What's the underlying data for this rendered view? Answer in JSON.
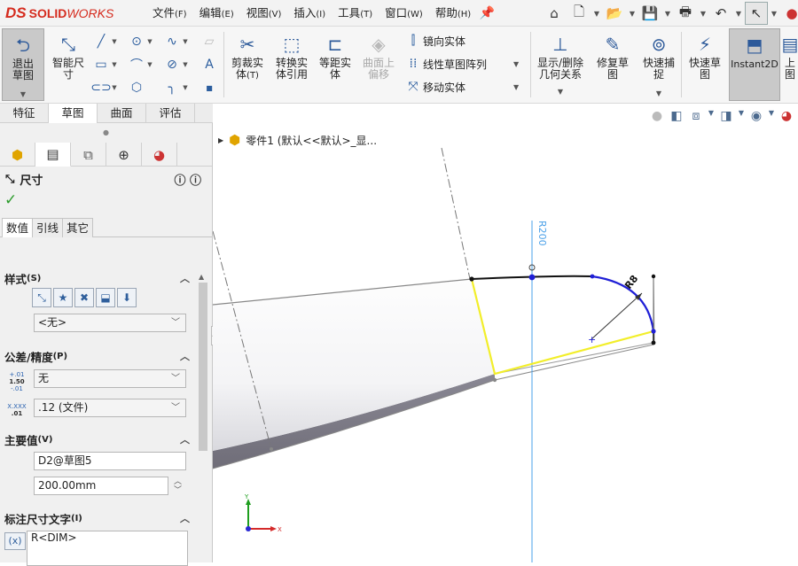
{
  "app": {
    "logo_prefix": "DS",
    "logo_name_bold": "SOLID",
    "logo_name_italic": "WORKS"
  },
  "menu": [
    {
      "label": "文件",
      "key": "(F)"
    },
    {
      "label": "编辑",
      "key": "(E)"
    },
    {
      "label": "视图",
      "key": "(V)"
    },
    {
      "label": "插入",
      "key": "(I)"
    },
    {
      "label": "工具",
      "key": "(T)"
    },
    {
      "label": "窗口",
      "key": "(W)"
    },
    {
      "label": "帮助",
      "key": "(H)"
    }
  ],
  "quick_icons": [
    "home-icon",
    "new-document-icon",
    "open-icon",
    "save-icon",
    "print-icon",
    "undo-icon",
    "select-cursor-icon",
    "options-icon",
    "traffic-light-icon"
  ],
  "ribbon": {
    "exit_sketch": "退出草图",
    "smart_dimension": "智能尺寸",
    "trim_entities": "剪裁实体",
    "trim_entities_key": "(T)",
    "convert_entities": "转换实体引用",
    "offset_entities": "等距实体",
    "offset_on_surface": "曲面上偏移",
    "mirror_entities": "镜向实体",
    "linear_pattern": "线性草图阵列",
    "move_entities": "移动实体",
    "display_delete_relations": "显示/删除几何关系",
    "repair_sketch": "修复草图",
    "quick_snaps": "快速捕捉",
    "rapid_sketch": "快速草图",
    "instant2d": "Instant2D",
    "last_partial": "上图"
  },
  "command_tabs": [
    "特征",
    "草图",
    "曲面",
    "评估"
  ],
  "feature_tabs": [
    "feature-manager-icon",
    "property-manager-icon",
    "configuration-manager-icon",
    "dimxpert-icon",
    "display-manager-icon"
  ],
  "property_manager": {
    "title": "尺寸",
    "subtabs": [
      "数值",
      "引线",
      "其它"
    ],
    "style_group": {
      "title": "样式",
      "key": "(S)",
      "selected": "<无>"
    },
    "tolerance_group": {
      "title": "公差/精度",
      "key": "(P)",
      "tolerance": "无",
      "precision": ".12 (文件)",
      "tol_icon_lines": [
        "+.01",
        "1.50",
        "-.01"
      ],
      "prec_icon_lines": [
        "X.XXX",
        ".01"
      ]
    },
    "primary_value_group": {
      "title": "主要值",
      "key": "(V)",
      "name": "D2@草图5",
      "value": "200.00mm"
    },
    "dimension_text_group": {
      "title": "标注尺寸文字",
      "key": "(I)",
      "text": "R<DIM>"
    }
  },
  "viewport": {
    "breadcrumb": "零件1  (默认<<默认>_显...",
    "dim_label_vertical": "R200",
    "dim_label_arc": "R8",
    "triad": {
      "y": "Y",
      "x": "X"
    }
  },
  "colors": {
    "sketch_black": "#111111",
    "sketch_blue": "#1f1fd6",
    "sketch_yellow": "#f2ee2a",
    "dim_blue": "#4aa0e8",
    "body_gray": "#7d7b85"
  }
}
